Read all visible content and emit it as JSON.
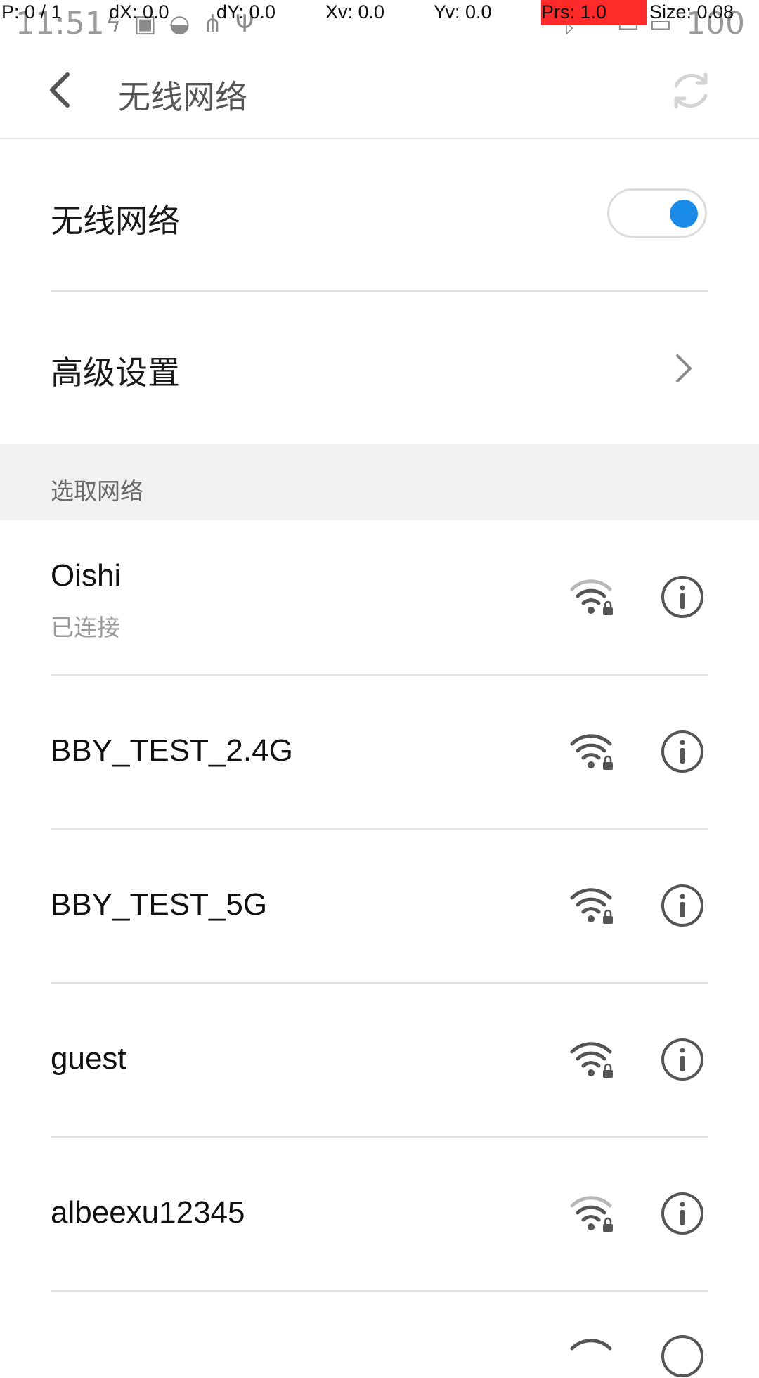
{
  "status_bar": {
    "time": "11:51",
    "battery": "100",
    "left_icons": [
      "flash-icon",
      "download-icon",
      "sync-icon",
      "share-icon",
      "usb-icon"
    ],
    "right_icons": [
      "bluetooth-icon",
      "wifi-icon",
      "sim-icon",
      "battery-icon"
    ]
  },
  "debug_overlay": {
    "p": "P: 0 / 1",
    "dx": "dX: 0.0",
    "dy": "dY: 0.0",
    "xv": "Xv: 0.0",
    "yv": "Yv: 0.0",
    "prs": "Prs: 1.0",
    "size": "Size: 0.08",
    "highlight_color": "#ff2a2a"
  },
  "app_bar": {
    "title": "无线网络",
    "back_icon": "back-arrow-icon",
    "refresh_icon": "refresh-icon"
  },
  "wifi_toggle": {
    "label": "无线网络",
    "enabled": true,
    "accent_color": "#1a8be8"
  },
  "advanced": {
    "label": "高级设置",
    "icon": "chevron-right-icon"
  },
  "section": {
    "label": "选取网络"
  },
  "networks": [
    {
      "name": "Oishi",
      "status": "已连接",
      "secured": true,
      "signal": "medium"
    },
    {
      "name": "BBY_TEST_2.4G",
      "status": "",
      "secured": true,
      "signal": "full"
    },
    {
      "name": "BBY_TEST_5G",
      "status": "",
      "secured": true,
      "signal": "full"
    },
    {
      "name": "guest",
      "status": "",
      "secured": true,
      "signal": "full"
    },
    {
      "name": "albeexu12345",
      "status": "",
      "secured": true,
      "signal": "medium"
    }
  ]
}
